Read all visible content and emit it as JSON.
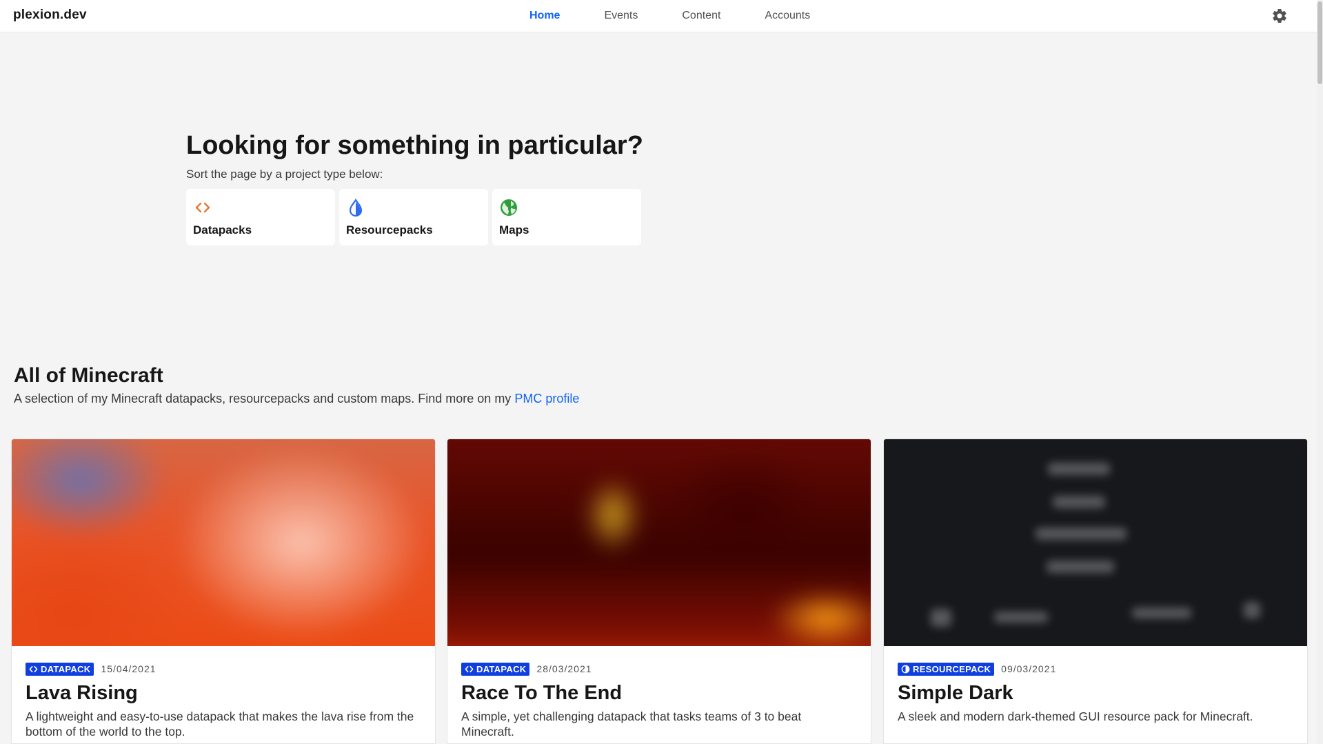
{
  "brand": "plexion.dev",
  "nav": {
    "items": [
      "Home",
      "Events",
      "Content",
      "Accounts"
    ],
    "active": "Home"
  },
  "icons": {
    "settings": "gear-icon",
    "datapack": "code-brackets-icon",
    "resourcepack": "droplet-icon",
    "map": "globe-icon"
  },
  "colors": {
    "accent": "#0f62fe",
    "badge": "#0f3fe0",
    "datapack_icon": "#e8782b",
    "resourcepack_icon": "#2f6cf0",
    "map_icon": "#2e9e3a"
  },
  "hero": {
    "title": "Looking for something in particular?",
    "subtitle": "Sort the page by a project type below:",
    "tiles": [
      {
        "label": "Datapacks"
      },
      {
        "label": "Resourcepacks"
      },
      {
        "label": "Maps"
      }
    ]
  },
  "section": {
    "title": "All of Minecraft",
    "description": "A selection of my Minecraft datapacks, resourcepacks and custom maps. Find more on my ",
    "link_text": "PMC profile"
  },
  "cards": [
    {
      "badge": "DATAPACK",
      "date": "15/04/2021",
      "title": "Lava Rising",
      "description": "A lightweight and easy-to-use datapack that makes the lava rise from the bottom of the world to the top."
    },
    {
      "badge": "DATAPACK",
      "date": "28/03/2021",
      "title": "Race To The End",
      "description": "A simple, yet challenging datapack that tasks teams of 3 to beat Minecraft."
    },
    {
      "badge": "RESOURCEPACK",
      "date": "09/03/2021",
      "title": "Simple Dark",
      "description": "A sleek and modern dark-themed GUI resource pack for Minecraft."
    }
  ]
}
